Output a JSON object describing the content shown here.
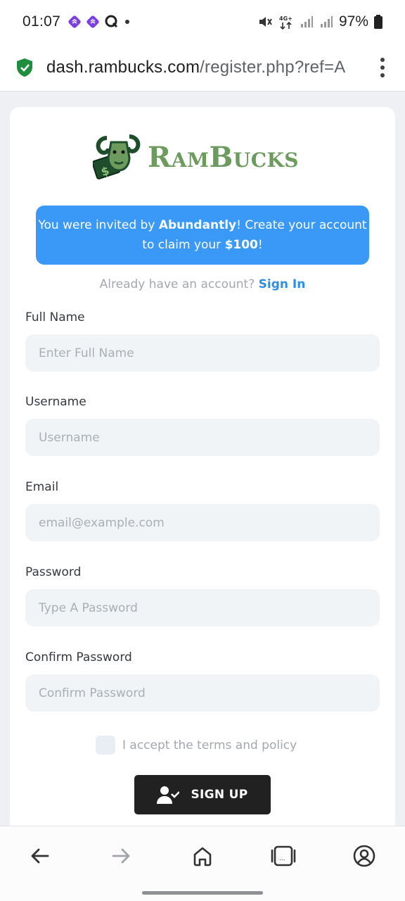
{
  "status_bar": {
    "time": "01:07",
    "battery": "97%",
    "network": "4G+"
  },
  "browser": {
    "url_host": "dash.rambucks.com",
    "url_path": "/register.php?ref=A"
  },
  "brand": {
    "name": "RamBucks",
    "logo_color": "#6d9a5d"
  },
  "invite": {
    "prefix": "You were invited by ",
    "inviter": "Abundantly",
    "middle": "! Create your account to claim your ",
    "amount": "$100",
    "suffix": "!"
  },
  "signin": {
    "prompt": "Already have an account?",
    "link": "Sign In"
  },
  "form": {
    "full_name": {
      "label": "Full Name",
      "placeholder": "Enter Full Name"
    },
    "username": {
      "label": "Username",
      "placeholder": "Username"
    },
    "email": {
      "label": "Email",
      "placeholder": "email@example.com"
    },
    "password": {
      "label": "Password",
      "placeholder": "Type A Password"
    },
    "confirm_password": {
      "label": "Confirm Password",
      "placeholder": "Confirm Password"
    },
    "terms_label": "I accept the terms and policy",
    "submit_label": "SIGN UP"
  },
  "colors": {
    "accent": "#3a99f7",
    "link": "#2b8fe6",
    "button": "#212121"
  },
  "nav": [
    "back-icon",
    "forward-icon",
    "home-icon",
    "tabs-icon",
    "account-icon"
  ]
}
